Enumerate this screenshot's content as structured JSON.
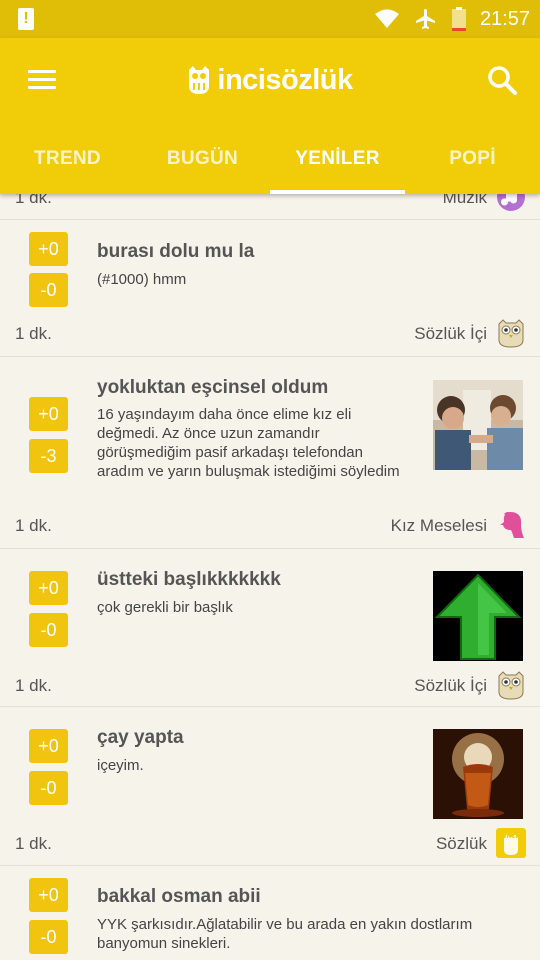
{
  "statusbar": {
    "time": "21:57"
  },
  "header": {
    "brand": "incisözlük"
  },
  "tabs": [
    {
      "label": "TREND"
    },
    {
      "label": "BUGÜN"
    },
    {
      "label": "YENİLER"
    },
    {
      "label": "POPİ"
    }
  ],
  "partial": {
    "time": "1 dk.",
    "category": "Müzik"
  },
  "entries": [
    {
      "up": "+0",
      "down": "-0",
      "title": "burası dolu mu la",
      "body": "(#1000) hmm",
      "time": "1 dk.",
      "category": "Sözlük İçi"
    },
    {
      "up": "+0",
      "down": "-3",
      "title": "yokluktan eşcinsel oldum",
      "body": "16 yaşındayım daha önce elime kız eli değmedi. Az önce uzun zamandır görüşmediğim pasif arkadaşı telefondan aradım ve yarın buluşmak istediğimi söyledim",
      "time": "1 dk.",
      "category": "Kız Meselesi"
    },
    {
      "up": "+0",
      "down": "-0",
      "title": "üstteki başlıkkkkkkk",
      "body": "çok gerekli bir başlık",
      "time": "1 dk.",
      "category": "Sözlük İçi"
    },
    {
      "up": "+0",
      "down": "-0",
      "title": "çay yapta",
      "body": "içeyim.",
      "time": "1 dk.",
      "category": "Sözlük"
    },
    {
      "up": "+0",
      "down": "-0",
      "title": "bakkal osman abii",
      "body": "YYK şarkısıdır.Ağlatabilir ve bu arada en yakın dostlarım banyomun sinekleri."
    }
  ],
  "icons": {
    "battery_alert": "alert-icon",
    "wifi": "wifi-icon",
    "airplane": "airplane-icon",
    "battery": "battery-icon",
    "menu": "menu-icon",
    "search": "search-icon",
    "music": "music-icon",
    "owl": "owl-icon",
    "girl": "girl-icon",
    "sozluk_badge": "inci-badge-icon"
  },
  "badge_text": "inci",
  "colors": {
    "primary": "#f1cc08",
    "status": "#e0bd06",
    "vote": "#f1c40f",
    "background": "#f5f3ea"
  }
}
